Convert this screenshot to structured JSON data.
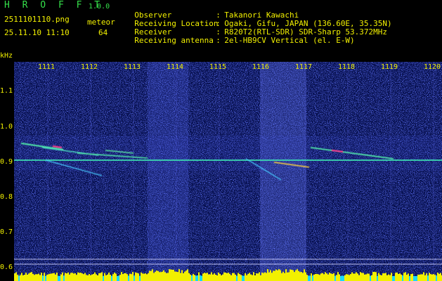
{
  "header": {
    "brand": "H R O F F T",
    "version": "1.0.0",
    "file_name": "2511101110.png",
    "event_type": "meteor",
    "timestamp": "25.11.10 11:10",
    "count": "64"
  },
  "info": [
    {
      "key": "Observer",
      "value": "Takanori Kawachi"
    },
    {
      "key": "Receiving Location",
      "value": "Ogaki, Gifu, JAPAN (136.60E, 35.35N)"
    },
    {
      "key": "Receiver",
      "value": "R820T2(RTL-SDR) SDR-Sharp 53.372MHz"
    },
    {
      "key": "Receiving antenna",
      "value": "2el-HB9CV Vertical (el. E-W)"
    }
  ],
  "axis": {
    "y_unit": "kHz",
    "y_ticks": [
      "1.1",
      "1.0",
      "0.9",
      "0.8",
      "0.7",
      "0.6"
    ],
    "minute_labels": [
      "1111",
      "1112",
      "1113",
      "1114",
      "1115",
      "1116",
      "1117",
      "1118",
      "1119",
      "1120"
    ]
  },
  "colors": {
    "background": "#000000",
    "label": "#f2f000",
    "brand": "#35e04a",
    "noise": "#1a22a8",
    "echo": "#40e0b0",
    "echo_core": "#ff3a8c",
    "power_bar": "#f2f000",
    "power_bar_low": "#18d8ff"
  }
}
